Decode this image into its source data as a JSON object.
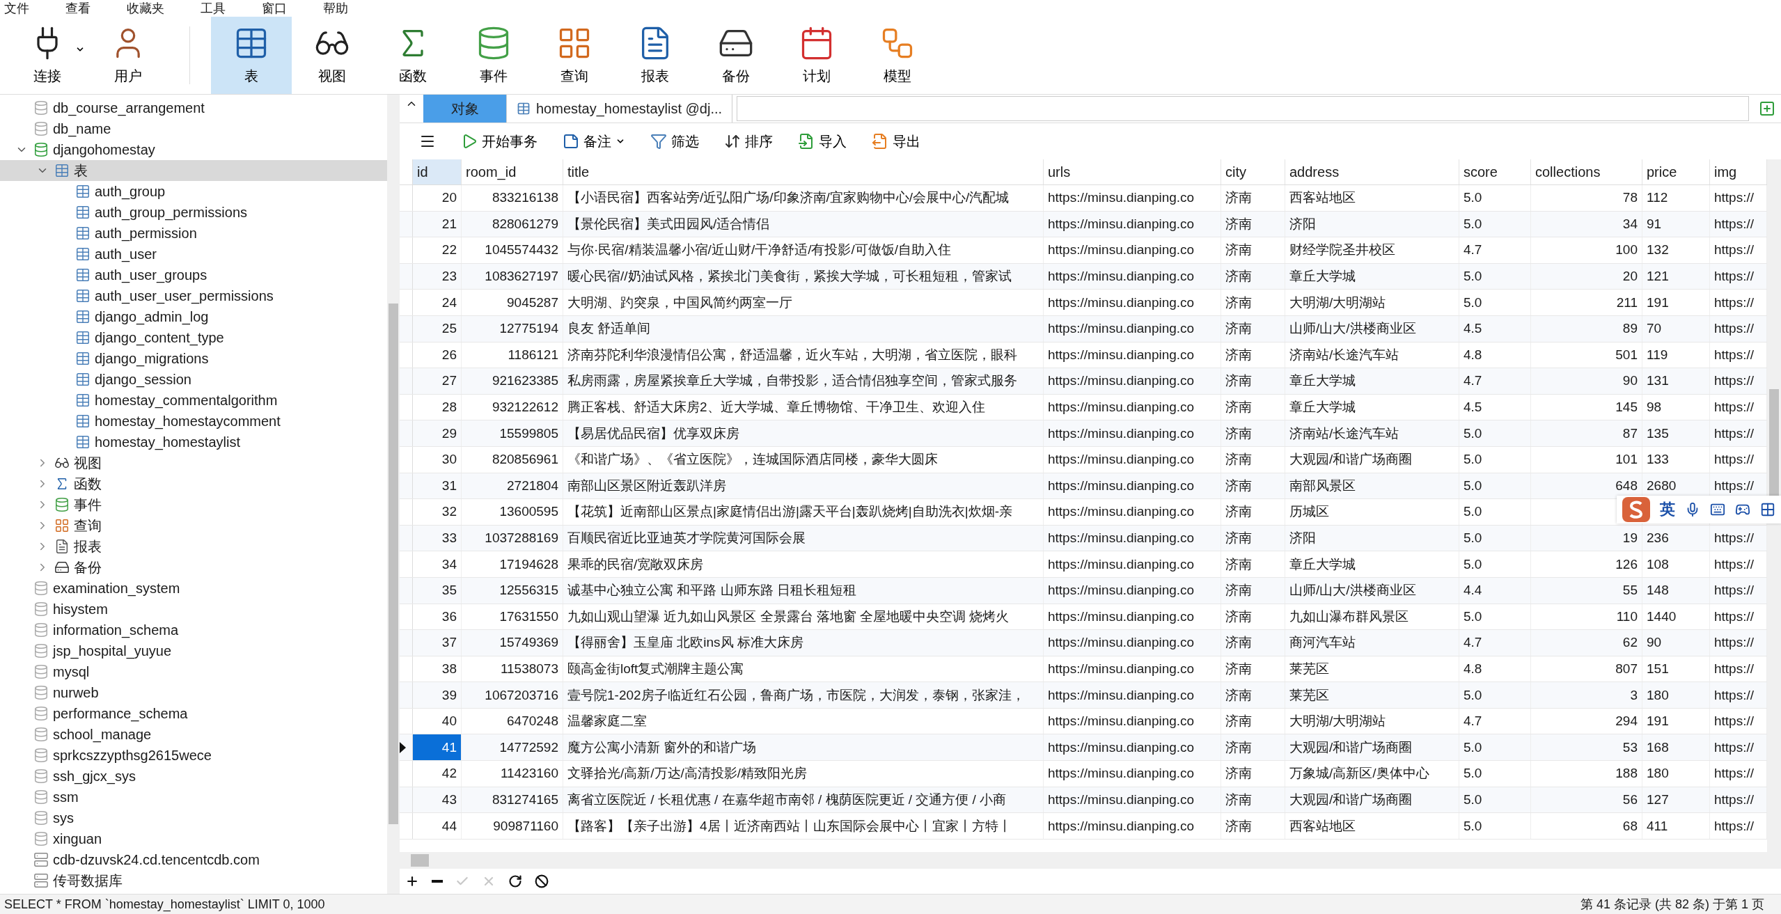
{
  "menu": [
    "文件",
    "查看",
    "收藏夹",
    "工具",
    "窗口",
    "帮助"
  ],
  "toolbar": [
    {
      "kind": "connection",
      "label": "连接",
      "dropdown": true,
      "selected": false
    },
    {
      "kind": "user",
      "label": "用户",
      "dropdown": false,
      "selected": false
    },
    {
      "kind": "table",
      "label": "表",
      "dropdown": false,
      "selected": true
    },
    {
      "kind": "view",
      "label": "视图",
      "dropdown": false,
      "selected": false
    },
    {
      "kind": "function",
      "label": "函数",
      "dropdown": false,
      "selected": false
    },
    {
      "kind": "event",
      "label": "事件",
      "dropdown": false,
      "selected": false
    },
    {
      "kind": "query",
      "label": "查询",
      "dropdown": false,
      "selected": false
    },
    {
      "kind": "report",
      "label": "报表",
      "dropdown": false,
      "selected": false
    },
    {
      "kind": "backup",
      "label": "备份",
      "dropdown": false,
      "selected": false
    },
    {
      "kind": "schedule",
      "label": "计划",
      "dropdown": false,
      "selected": false
    },
    {
      "kind": "model",
      "label": "模型",
      "dropdown": false,
      "selected": false
    }
  ],
  "sidebar": {
    "items": [
      {
        "kind": "database",
        "label": "db_course_arrangement",
        "selected": false
      },
      {
        "kind": "database",
        "label": "db_name",
        "selected": false
      },
      {
        "kind": "database",
        "label": "djangohomestay",
        "expanded": true,
        "selected": false,
        "children": [
          {
            "kind": "tables",
            "label": "表",
            "expanded": true,
            "selected": true,
            "children": [
              {
                "kind": "table",
                "label": "auth_group",
                "selected": false
              },
              {
                "kind": "table",
                "label": "auth_group_permissions",
                "selected": false
              },
              {
                "kind": "table",
                "label": "auth_permission",
                "selected": false
              },
              {
                "kind": "table",
                "label": "auth_user",
                "selected": false
              },
              {
                "kind": "table",
                "label": "auth_user_groups",
                "selected": false
              },
              {
                "kind": "table",
                "label": "auth_user_user_permissions",
                "selected": false
              },
              {
                "kind": "table",
                "label": "django_admin_log",
                "selected": false
              },
              {
                "kind": "table",
                "label": "django_content_type",
                "selected": false
              },
              {
                "kind": "table",
                "label": "django_migrations",
                "selected": false
              },
              {
                "kind": "table",
                "label": "django_session",
                "selected": false
              },
              {
                "kind": "table",
                "label": "homestay_commentalgorithm",
                "selected": false
              },
              {
                "kind": "table",
                "label": "homestay_homestaycomment",
                "selected": false
              },
              {
                "kind": "table",
                "label": "homestay_homestaylist",
                "selected": false
              }
            ]
          },
          {
            "kind": "views",
            "label": "视图",
            "expanded": false,
            "selected": false
          },
          {
            "kind": "functions",
            "label": "函数",
            "expanded": false,
            "selected": false
          },
          {
            "kind": "events",
            "label": "事件",
            "expanded": false,
            "selected": false
          },
          {
            "kind": "queries",
            "label": "查询",
            "expanded": false,
            "selected": false
          },
          {
            "kind": "reports",
            "label": "报表",
            "expanded": false,
            "selected": false
          },
          {
            "kind": "backups",
            "label": "备份",
            "expanded": false,
            "selected": false
          }
        ]
      },
      {
        "kind": "database",
        "label": "examination_system",
        "selected": false
      },
      {
        "kind": "database",
        "label": "hisystem",
        "selected": false
      },
      {
        "kind": "database",
        "label": "information_schema",
        "selected": false
      },
      {
        "kind": "database",
        "label": "jsp_hospital_yuyue",
        "selected": false
      },
      {
        "kind": "database",
        "label": "mysql",
        "selected": false
      },
      {
        "kind": "database",
        "label": "nurweb",
        "selected": false
      },
      {
        "kind": "database",
        "label": "performance_schema",
        "selected": false
      },
      {
        "kind": "database",
        "label": "school_manage",
        "selected": false
      },
      {
        "kind": "database",
        "label": "sprkcszzypthsg2615wece",
        "selected": false
      },
      {
        "kind": "database",
        "label": "ssh_gjcx_sys",
        "selected": false
      },
      {
        "kind": "database",
        "label": "ssm",
        "selected": false
      },
      {
        "kind": "database",
        "label": "sys",
        "selected": false
      },
      {
        "kind": "database",
        "label": "xinguan",
        "selected": false
      },
      {
        "kind": "connection",
        "label": "cdb-dzuvsk24.cd.tencentcdb.com",
        "selected": false
      },
      {
        "kind": "connection",
        "label": "传哥数据库",
        "selected": false
      }
    ]
  },
  "tabs": [
    {
      "label": "对象",
      "selected": true
    },
    {
      "label": "homestay_homestaylist @dj...",
      "selected": false
    }
  ],
  "actions": [
    {
      "kind": "menu"
    },
    {
      "kind": "transaction",
      "label": "开始事务"
    },
    {
      "kind": "note",
      "label": "备注",
      "dropdown": true
    },
    {
      "kind": "filter",
      "label": "筛选"
    },
    {
      "kind": "sort",
      "label": "排序"
    },
    {
      "kind": "import",
      "label": "导入"
    },
    {
      "kind": "export",
      "label": "导出"
    }
  ],
  "table": {
    "columns": [
      {
        "label": "id",
        "selected": true
      },
      {
        "label": "room_id",
        "selected": false
      },
      {
        "label": "title",
        "selected": false
      },
      {
        "label": "urls",
        "selected": false
      },
      {
        "label": "city",
        "selected": false
      },
      {
        "label": "address",
        "selected": false
      },
      {
        "label": "score",
        "selected": false
      },
      {
        "label": "collections",
        "selected": false
      },
      {
        "label": "price",
        "selected": false
      },
      {
        "label": "img",
        "selected": false
      }
    ],
    "rows": [
      {
        "id": "20",
        "room_id": "833216138",
        "title": "【小语民宿】西客站旁/近弘阳广场/印象济南/宜家购物中心/会展中心/汽配城",
        "urls": "https://minsu.dianping.co",
        "city": "济南",
        "address": "西客站地区",
        "score": "5.0",
        "collections": "78",
        "price": "112",
        "img": "https://",
        "selected": false
      },
      {
        "id": "21",
        "room_id": "828061279",
        "title": "【景伦民宿】美式田园风/适合情侣",
        "urls": "https://minsu.dianping.co",
        "city": "济南",
        "address": "济阳",
        "score": "5.0",
        "collections": "34",
        "price": "91",
        "img": "https://",
        "selected": false
      },
      {
        "id": "22",
        "room_id": "1045574432",
        "title": "与你·民宿/精装温馨小宿/近山财/干净舒适/有投影/可做饭/自助入住",
        "urls": "https://minsu.dianping.co",
        "city": "济南",
        "address": "财经学院圣井校区",
        "score": "4.7",
        "collections": "100",
        "price": "132",
        "img": "https://",
        "selected": false
      },
      {
        "id": "23",
        "room_id": "1083627197",
        "title": "暖心民宿//奶油试风格，紧挨北门美食街，紧挨大学城，可长租短租，管家试",
        "urls": "https://minsu.dianping.co",
        "city": "济南",
        "address": "章丘大学城",
        "score": "5.0",
        "collections": "20",
        "price": "121",
        "img": "https://",
        "selected": false
      },
      {
        "id": "24",
        "room_id": "9045287",
        "title": "大明湖、趵突泉，中国风简约两室一厅",
        "urls": "https://minsu.dianping.co",
        "city": "济南",
        "address": "大明湖/大明湖站",
        "score": "5.0",
        "collections": "211",
        "price": "191",
        "img": "https://",
        "selected": false
      },
      {
        "id": "25",
        "room_id": "12775194",
        "title": "良友 舒适单间",
        "urls": "https://minsu.dianping.co",
        "city": "济南",
        "address": "山师/山大/洪楼商业区",
        "score": "4.5",
        "collections": "89",
        "price": "70",
        "img": "https://",
        "selected": false
      },
      {
        "id": "26",
        "room_id": "1186121",
        "title": "济南芬陀利华浪漫情侣公寓，舒适温馨，近火车站，大明湖，省立医院，眼科",
        "urls": "https://minsu.dianping.co",
        "city": "济南",
        "address": "济南站/长途汽车站",
        "score": "4.8",
        "collections": "501",
        "price": "119",
        "img": "https://",
        "selected": false
      },
      {
        "id": "27",
        "room_id": "921623385",
        "title": "私房雨露，房屋紧挨章丘大学城，自带投影，适合情侣独享空间，管家式服务",
        "urls": "https://minsu.dianping.co",
        "city": "济南",
        "address": "章丘大学城",
        "score": "4.7",
        "collections": "90",
        "price": "131",
        "img": "https://",
        "selected": false
      },
      {
        "id": "28",
        "room_id": "932122612",
        "title": "腾正客栈、舒适大床房2、近大学城、章丘博物馆、干净卫生、欢迎入住",
        "urls": "https://minsu.dianping.co",
        "city": "济南",
        "address": "章丘大学城",
        "score": "4.5",
        "collections": "145",
        "price": "98",
        "img": "https://",
        "selected": false
      },
      {
        "id": "29",
        "room_id": "15599805",
        "title": "【易居优品民宿】优享双床房",
        "urls": "https://minsu.dianping.co",
        "city": "济南",
        "address": "济南站/长途汽车站",
        "score": "5.0",
        "collections": "87",
        "price": "135",
        "img": "https://",
        "selected": false
      },
      {
        "id": "30",
        "room_id": "820856961",
        "title": "《和谐广场》、《省立医院》，连城国际酒店同楼，豪华大圆床",
        "urls": "https://minsu.dianping.co",
        "city": "济南",
        "address": "大观园/和谐广场商圈",
        "score": "5.0",
        "collections": "101",
        "price": "133",
        "img": "https://",
        "selected": false
      },
      {
        "id": "31",
        "room_id": "2721804",
        "title": "南部山区景区附近轰趴洋房",
        "urls": "https://minsu.dianping.co",
        "city": "济南",
        "address": "南部风景区",
        "score": "5.0",
        "collections": "648",
        "price": "2680",
        "img": "https://",
        "selected": false
      },
      {
        "id": "32",
        "room_id": "13600595",
        "title": "【花筑】近南部山区景点|家庭情侣出游|露天平台|轰趴烧烤|自助洗衣|炊烟-亲",
        "urls": "https://minsu.dianping.co",
        "city": "济南",
        "address": "历城区",
        "score": "5.0",
        "selected": false
      },
      {
        "id": "33",
        "room_id": "1037288169",
        "title": "百顺民宿近比亚迪英才学院黄河国际会展",
        "urls": "https://minsu.dianping.co",
        "city": "济南",
        "address": "济阳",
        "score": "5.0",
        "collections": "19",
        "price": "236",
        "img": "https://",
        "selected": false
      },
      {
        "id": "34",
        "room_id": "17194628",
        "title": "果乖的民宿/宽敞双床房",
        "urls": "https://minsu.dianping.co",
        "city": "济南",
        "address": "章丘大学城",
        "score": "5.0",
        "collections": "126",
        "price": "108",
        "img": "https://",
        "selected": false
      },
      {
        "id": "35",
        "room_id": "12556315",
        "title": "诚基中心独立公寓 和平路 山师东路 日租长租短租",
        "urls": "https://minsu.dianping.co",
        "city": "济南",
        "address": "山师/山大/洪楼商业区",
        "score": "4.4",
        "collections": "55",
        "price": "148",
        "img": "https://",
        "selected": false
      },
      {
        "id": "36",
        "room_id": "17631550",
        "title": "九如山观山望瀑 近九如山风景区 全景露台 落地窗 全屋地暖中央空调 烧烤火",
        "urls": "https://minsu.dianping.co",
        "city": "济南",
        "address": "九如山瀑布群风景区",
        "score": "5.0",
        "collections": "110",
        "price": "1440",
        "img": "https://",
        "selected": false
      },
      {
        "id": "37",
        "room_id": "15749369",
        "title": "【得丽舍】玉皇庙 北欧ins风 标准大床房",
        "urls": "https://minsu.dianping.co",
        "city": "济南",
        "address": "商河汽车站",
        "score": "4.7",
        "collections": "62",
        "price": "90",
        "img": "https://",
        "selected": false
      },
      {
        "id": "38",
        "room_id": "11538073",
        "title": "颐高金街loft复式潮牌主题公寓",
        "urls": "https://minsu.dianping.co",
        "city": "济南",
        "address": "莱芜区",
        "score": "4.8",
        "collections": "807",
        "price": "151",
        "img": "https://",
        "selected": false
      },
      {
        "id": "39",
        "room_id": "1067203716",
        "title": "壹号院1-202房子临近红石公园，鲁商广场，市医院，大润发，泰钢，张家洼，",
        "urls": "https://minsu.dianping.co",
        "city": "济南",
        "address": "莱芜区",
        "score": "5.0",
        "collections": "3",
        "price": "180",
        "img": "https://",
        "selected": false
      },
      {
        "id": "40",
        "room_id": "6470248",
        "title": "温馨家庭二室",
        "urls": "https://minsu.dianping.co",
        "city": "济南",
        "address": "大明湖/大明湖站",
        "score": "4.7",
        "collections": "294",
        "price": "191",
        "img": "https://",
        "selected": false
      },
      {
        "id": "41",
        "room_id": "14772592",
        "title": "魔方公寓小清新 窗外的和谐广场",
        "urls": "https://minsu.dianping.co",
        "city": "济南",
        "address": "大观园/和谐广场商圈",
        "score": "5.0",
        "collections": "53",
        "price": "168",
        "img": "https://",
        "selected": true
      },
      {
        "id": "42",
        "room_id": "11423160",
        "title": "文驿拾光/高新/万达/高清投影/精致阳光房",
        "urls": "https://minsu.dianping.co",
        "city": "济南",
        "address": "万象城/高新区/奥体中心",
        "score": "5.0",
        "collections": "188",
        "price": "180",
        "img": "https://",
        "selected": false
      },
      {
        "id": "43",
        "room_id": "831274165",
        "title": "离省立医院近 / 长租优惠 / 在嘉华超市南邻 / 槐荫医院更近 / 交通方便 / 小商",
        "urls": "https://minsu.dianping.co",
        "city": "济南",
        "address": "大观园/和谐广场商圈",
        "score": "5.0",
        "collections": "56",
        "price": "127",
        "img": "https://",
        "selected": false
      },
      {
        "id": "44",
        "room_id": "909871160",
        "title": "【路客】【亲子出游】4居丨近济南西站丨山东国际会展中心丨宜家丨方特丨",
        "urls": "https://minsu.dianping.co",
        "city": "济南",
        "address": "西客站地区",
        "score": "5.0",
        "collections": "68",
        "price": "411",
        "img": "https://",
        "selected": false
      }
    ]
  },
  "record_actions": [
    {
      "kind": "add",
      "disabled": false
    },
    {
      "kind": "delete",
      "disabled": false
    },
    {
      "kind": "apply",
      "disabled": true
    },
    {
      "kind": "discard",
      "disabled": true
    },
    {
      "kind": "refresh",
      "disabled": false
    },
    {
      "kind": "stop",
      "disabled": false
    }
  ],
  "ime_toolbar": {
    "mode": "英"
  },
  "status_bar": {
    "query": "SELECT * FROM `homestay_homestaylist` LIMIT 0, 1000",
    "position": "第 41 条记录 (共 82 条) 于第 1 页"
  }
}
